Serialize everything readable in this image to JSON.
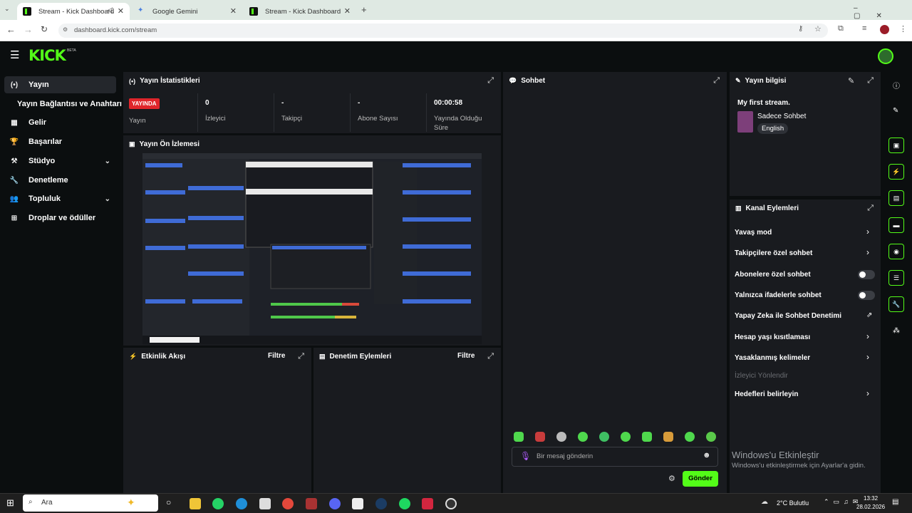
{
  "browser": {
    "tabs": [
      {
        "label": "Stream - Kick Dashboard",
        "active": true
      },
      {
        "label": "Google Gemini",
        "active": false
      },
      {
        "label": "Stream - Kick Dashboard",
        "active": false
      }
    ],
    "url": "dashboard.kick.com/stream"
  },
  "header": {
    "logo": "KICK",
    "badge": "BETA"
  },
  "sidebar": {
    "items": [
      {
        "label": "Yayın",
        "icon": "broadcast-icon",
        "glyph": "(•)"
      },
      {
        "label": "Yayın Bağlantısı ve Anahtarı",
        "icon": "",
        "glyph": ""
      },
      {
        "label": "Gelir",
        "icon": "chart-icon",
        "glyph": "▦"
      },
      {
        "label": "Başarılar",
        "icon": "trophy-icon",
        "glyph": "🏆"
      },
      {
        "label": "Stüdyo",
        "icon": "tools-icon",
        "glyph": "⚒"
      },
      {
        "label": "Denetleme",
        "icon": "wrench-icon",
        "glyph": "🔧"
      },
      {
        "label": "Topluluk",
        "icon": "people-icon",
        "glyph": "👥"
      },
      {
        "label": "Droplar ve ödüller",
        "icon": "gift-icon",
        "glyph": "⊞"
      }
    ]
  },
  "stats": {
    "title": "Yayın İstatistikleri",
    "live_badge": "YAYINDA",
    "live_label": "Yayın",
    "viewers_value": "0",
    "viewers_label": "İzleyici",
    "followers_value": "-",
    "followers_label": "Takipçi",
    "subs_value": "-",
    "subs_label": "Abone Sayısı",
    "duration_value": "00:00:58",
    "duration_label": "Yayında Olduğu Süre"
  },
  "preview": {
    "title": "Yayın Ön İzlemesi"
  },
  "activity": {
    "title": "Etkinlik Akışı",
    "filter": "Filtre"
  },
  "moderation": {
    "title": "Denetim Eylemleri",
    "filter": "Filtre"
  },
  "chat": {
    "title": "Sohbet",
    "placeholder": "Bir mesaj gönderin",
    "send": "Gönder"
  },
  "info": {
    "title": "Yayın bilgisi",
    "stream_title": "My first stream.",
    "category": "Sadece Sohbet",
    "language": "English"
  },
  "actions": {
    "title": "Kanal Eylemleri",
    "items": [
      {
        "label": "Yavaş mod",
        "control": "chevron"
      },
      {
        "label": "Takipçilere özel sohbet",
        "control": "chevron"
      },
      {
        "label": "Abonelere özel sohbet",
        "control": "toggle"
      },
      {
        "label": "Yalnızca ifadelerle sohbet",
        "control": "toggle"
      },
      {
        "label": "Yapay Zeka ile Sohbet Denetimi",
        "control": "external"
      },
      {
        "label": "Hesap yaşı kısıtlaması",
        "control": "chevron"
      },
      {
        "label": "Yasaklanmış kelimeler",
        "control": "chevron"
      },
      {
        "label": "İzleyici Yönlendir",
        "control": "disabled"
      },
      {
        "label": "Hedefleri belirleyin",
        "control": "chevron"
      }
    ]
  },
  "windows": {
    "activate_title": "Windows'u Etkinleştir",
    "activate_sub": "Windows'u etkinleştirmek için Ayarlar'a gidin.",
    "search": "Ara",
    "weather": "2°C  Bulutlu",
    "time": "13:32",
    "date": "28.02.2026"
  },
  "colors": {
    "accent": "#53fc18",
    "live": "#e0252b",
    "panel": "#191b1f",
    "bg": "#0b0e0f"
  }
}
